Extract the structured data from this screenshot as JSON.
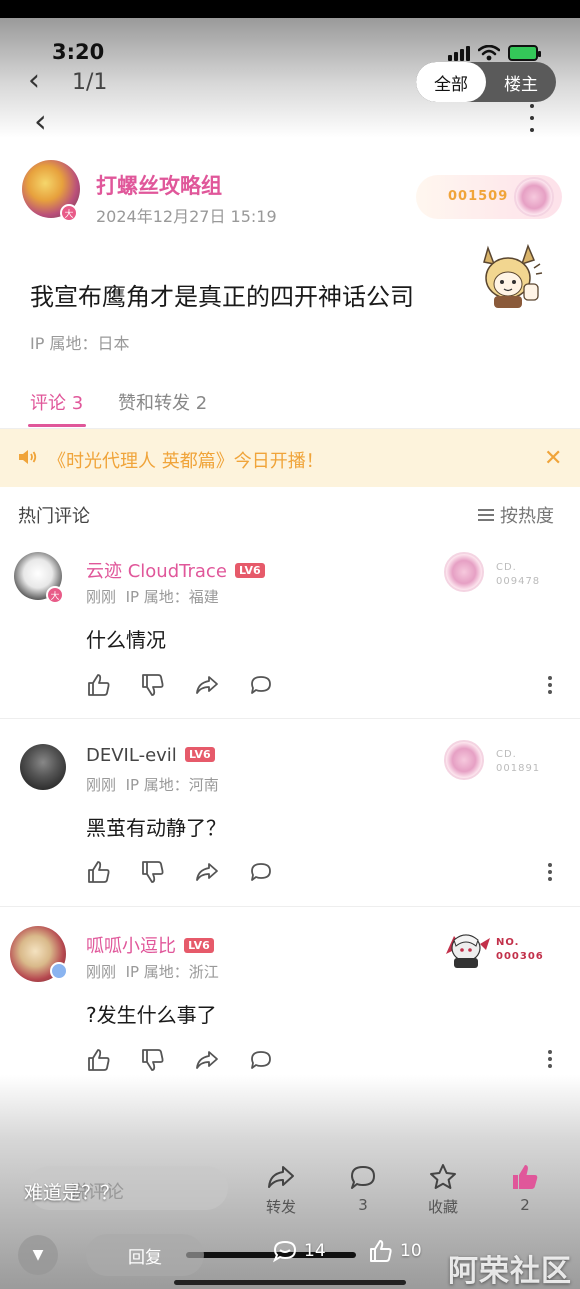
{
  "status_bar": {
    "time": "3:20"
  },
  "image_viewer": {
    "page_indicator": "1/1",
    "segments": [
      "全部",
      "楼主"
    ],
    "active_segment": "全部"
  },
  "post": {
    "author": "打螺丝攻略组",
    "date": "2024年12月27日 15:19",
    "medal_number": "001509",
    "title": "我宣布鹰角才是真正的四开神话公司",
    "ip_label": "IP 属地：日本",
    "avatar_badge": "大"
  },
  "tabs": {
    "comments": "评论 3",
    "likes_shares": "赞和转发 2"
  },
  "notice": {
    "text": "《时光代理人 英都篇》今日开播！",
    "close": "✕"
  },
  "comments_header": {
    "hot": "热门评论",
    "sort": "按热度"
  },
  "comments": [
    {
      "name": "云迹 CloudTrace",
      "level": "LV6",
      "time": "刚刚",
      "ip": "IP 属地：福建",
      "text": "什么情况",
      "medal_prefix": "CD.",
      "medal_no": "009478",
      "name_color": "#e0579a"
    },
    {
      "name": "DEVIL-evil",
      "level": "LV6",
      "time": "刚刚",
      "ip": "IP 属地：河南",
      "text": "黑茧有动静了？",
      "medal_prefix": "CD.",
      "medal_no": "001891",
      "name_color": "#444444"
    },
    {
      "name": "呱呱小逗比",
      "level": "LV6",
      "time": "刚刚",
      "ip": "IP 属地：浙江",
      "text": "?发生什么事了",
      "medal_prefix": "NO.",
      "medal_no": "000306",
      "name_color": "#e0579a"
    }
  ],
  "bottom_bar": {
    "comment_placeholder": "说评论",
    "overlay_text": "难道是？？",
    "share": "转发",
    "comment_count": "3",
    "favorite": "收藏",
    "like_count": "2"
  },
  "reply_bar": {
    "reply": "回复",
    "comment_count": "14",
    "like_count": "10"
  },
  "watermark": "阿荣社区",
  "colors": {
    "accent": "#e0579a",
    "notice_bg": "#fdf3dc",
    "notice_text": "#f0a43a",
    "level_badge": "#e65a6a"
  }
}
